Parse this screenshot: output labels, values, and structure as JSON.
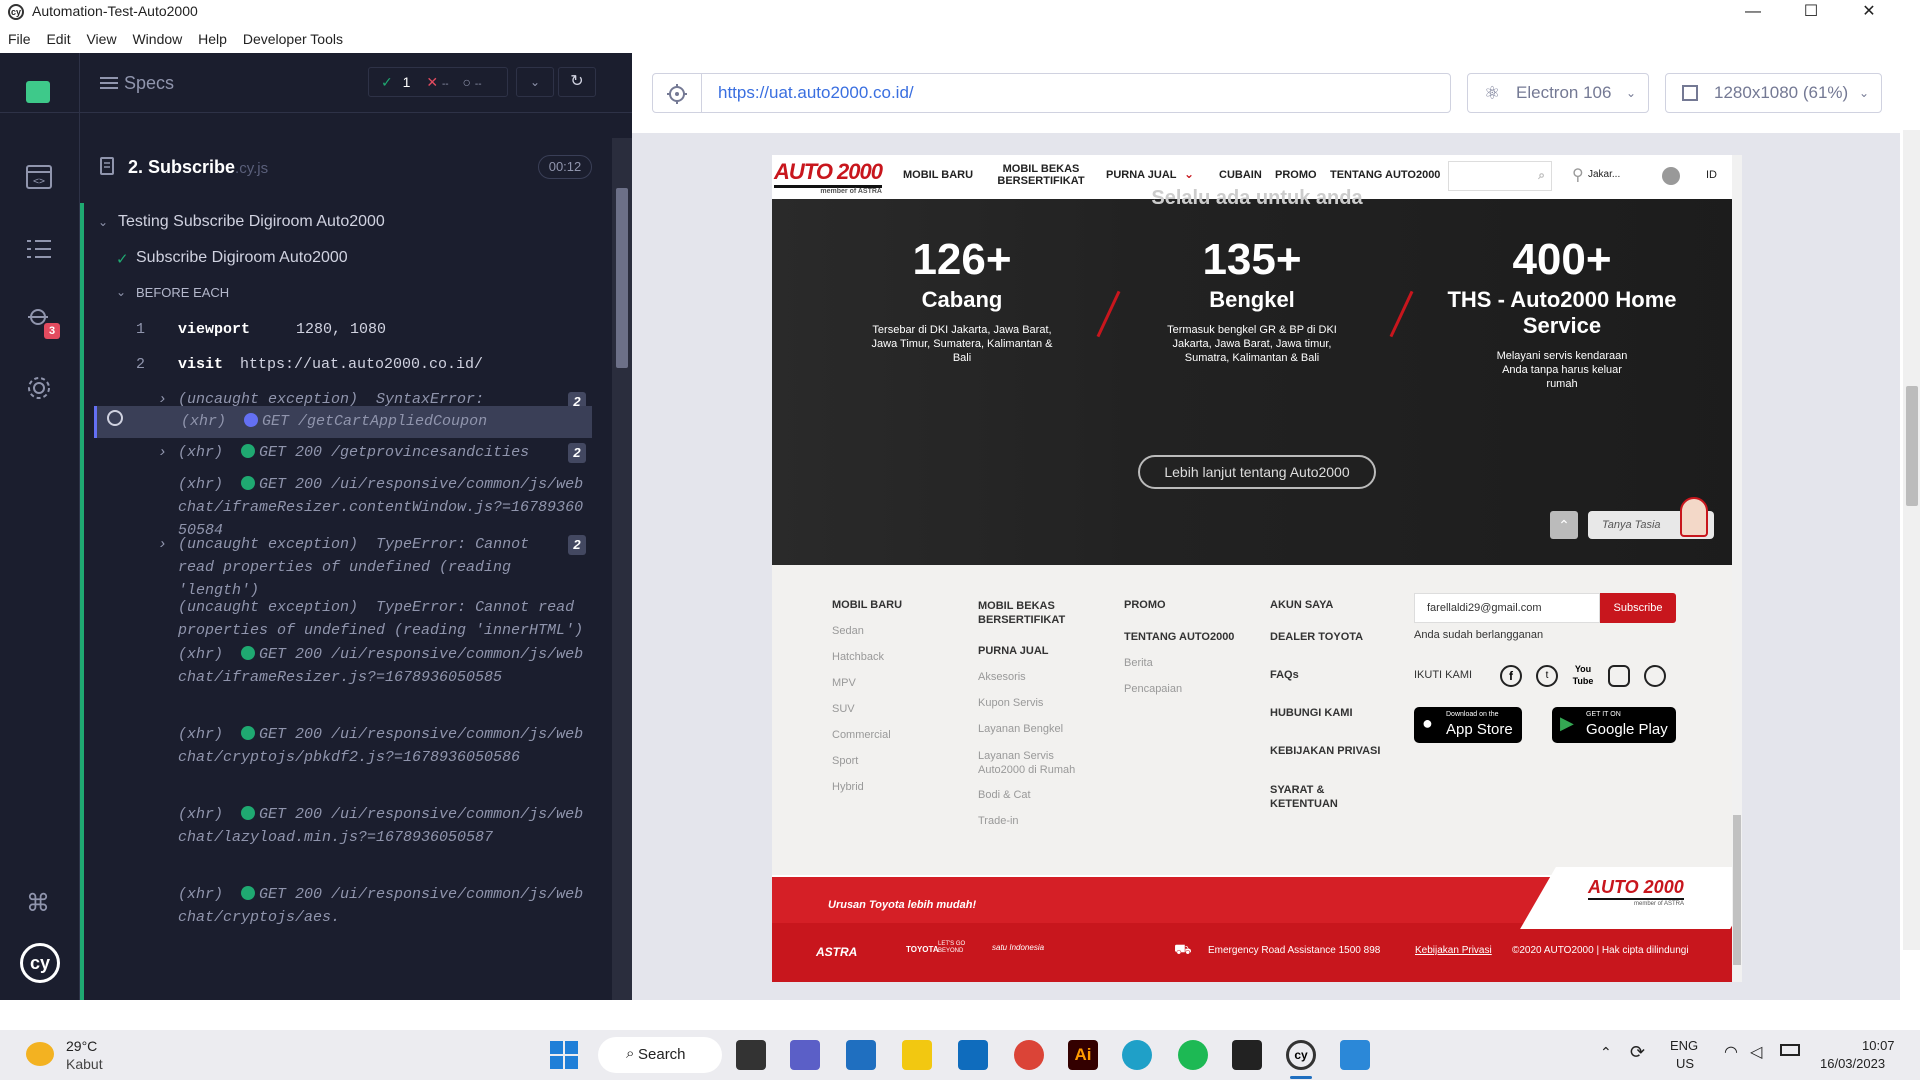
{
  "window": {
    "title": "Automation-Test-Auto2000"
  },
  "menu": [
    "File",
    "Edit",
    "View",
    "Window",
    "Help",
    "Developer Tools"
  ],
  "reporter": {
    "specs_label": "Specs",
    "passed": "1",
    "failed": "--",
    "pending": "--",
    "spec_name": "2. Subscribe",
    "spec_ext": ".cy.js",
    "duration": "00:12",
    "suite": "Testing Subscribe Digiroom Auto2000",
    "test": "Subscribe Digiroom Auto2000",
    "hook": "BEFORE EACH",
    "runs_badge": "3",
    "commands": [
      {
        "num": "1",
        "name": "viewport",
        "msg": "1280, 1080"
      },
      {
        "num": "2",
        "name": "visit",
        "msg": "https://uat.auto2000.co.id/"
      },
      {
        "name": "(uncaught exception)",
        "msg": "SyntaxError: Unexpected identifier 'ear'",
        "count": "2"
      },
      {
        "name": "(xhr)",
        "msg": "GET /getCartAppliedCoupon"
      },
      {
        "name": "(xhr)",
        "msg": "GET 200 /getprovincesandcities",
        "count": "2"
      },
      {
        "name": "(xhr)",
        "msg": "GET 200 /ui/responsive/common/js/webchat/iframeResizer.contentWindow.js?=1678936050584"
      },
      {
        "name": "(uncaught exception)",
        "msg": "TypeError: Cannot read properties of undefined (reading 'length')",
        "count": "2"
      },
      {
        "name": "(uncaught exception)",
        "msg": "TypeError: Cannot read properties of undefined (reading 'innerHTML')"
      },
      {
        "name": "(xhr)",
        "msg": "GET 200 /ui/responsive/common/js/webchat/iframeResizer.js?=1678936050585"
      },
      {
        "name": "(xhr)",
        "msg": "GET 200 /ui/responsive/common/js/webchat/cryptojs/pbkdf2.js?=1678936050586"
      },
      {
        "name": "(xhr)",
        "msg": "GET 200 /ui/responsive/common/js/webchat/lazyload.min.js?=1678936050587"
      },
      {
        "name": "(xhr)",
        "msg": "GET 200 /ui/responsive/common/js/webchat/cryptojs/aes."
      }
    ]
  },
  "browser": {
    "url": "https://uat.auto2000.co.id/",
    "engine": "Electron 106",
    "viewport": "1280x1080 (61%)"
  },
  "site": {
    "logo": "AUTO 2000",
    "logo_sub": "member of ASTRA",
    "nav": [
      "MOBIL BARU",
      "MOBIL BEKAS BERSERTIFIKAT",
      "PURNA JUAL",
      "CUBAIN",
      "PROMO",
      "TENTANG AUTO2000"
    ],
    "location": "Jakar...",
    "lang": "ID",
    "hero_partial_title": "Selalu ada untuk anda",
    "stats": [
      {
        "num": "126+",
        "label": "Cabang",
        "desc": "Tersebar di DKI Jakarta, Jawa Barat, Jawa Timur, Sumatera, Kalimantan & Bali"
      },
      {
        "num": "135+",
        "label": "Bengkel",
        "desc": "Termasuk bengkel GR & BP di DKI Jakarta, Jawa Barat, Jawa timur, Sumatra, Kalimantan & Bali"
      },
      {
        "num": "400+",
        "label": "THS - Auto2000 Home Service",
        "desc": "Melayani servis kendaraan Anda tanpa harus keluar rumah"
      }
    ],
    "more_button": "Lebih lanjut tentang Auto2000",
    "chat_label": "Tanya Tasia",
    "footer": {
      "col1_head": "MOBIL BARU",
      "col1": [
        "Sedan",
        "Hatchback",
        "MPV",
        "SUV",
        "Commercial",
        "Sport",
        "Hybrid"
      ],
      "col2_head": "MOBIL BEKAS BERSERTIFIKAT",
      "col2_sub": "PURNA JUAL",
      "col2": [
        "Aksesoris",
        "Kupon Servis",
        "Layanan Bengkel",
        "Layanan Servis Auto2000 di Rumah",
        "Bodi & Cat",
        "Trade-in"
      ],
      "col3_head": "PROMO",
      "col3_sub": "TENTANG AUTO2000",
      "col3": [
        "Berita",
        "Pencapaian"
      ],
      "col4": [
        "AKUN SAYA",
        "DEALER TOYOTA",
        "FAQs",
        "HUBUNGI KAMI",
        "KEBIJAKAN PRIVASI",
        "SYARAT & KETENTUAN"
      ],
      "email_value": "farellaldi29@gmail.com",
      "subscribe": "Subscribe",
      "subscribed_msg": "Anda sudah berlangganan",
      "follow": "IKUTI KAMI",
      "appstore_small": "Download on the",
      "appstore": "App Store",
      "gplay_small": "GET IT ON",
      "gplay": "Google Play"
    },
    "bottom": {
      "tagline": "Urusan Toyota lebih mudah!",
      "brands": [
        "ASTRA",
        "TOYOTA",
        "LET'S GO BEYOND",
        "satu Indonesia"
      ],
      "emergency": "Emergency Road Assistance 1500 898",
      "privacy": "Kebijakan Privasi",
      "copyright": "©2020 AUTO2000 | Hak cipta dilindungi"
    }
  },
  "taskbar": {
    "temp": "29°C",
    "weather": "Kabut",
    "search": "Search",
    "lang1": "ENG",
    "lang2": "US",
    "time": "10:07",
    "date": "16/03/2023"
  },
  "colors": {
    "cypress_bg": "#1b1e2e",
    "accent_red": "#c8161d",
    "pass_green": "#1fa971",
    "link_blue": "#3a6fe0"
  }
}
